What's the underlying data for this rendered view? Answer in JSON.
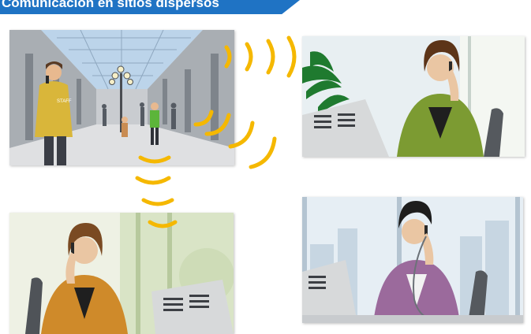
{
  "header": {
    "title": "Comunicación en sitios dispersos"
  },
  "scenes": {
    "mall": {
      "shirt_text": "STAFF"
    }
  },
  "colors": {
    "banner": "#1f73c4",
    "signal": "#f5b800"
  }
}
